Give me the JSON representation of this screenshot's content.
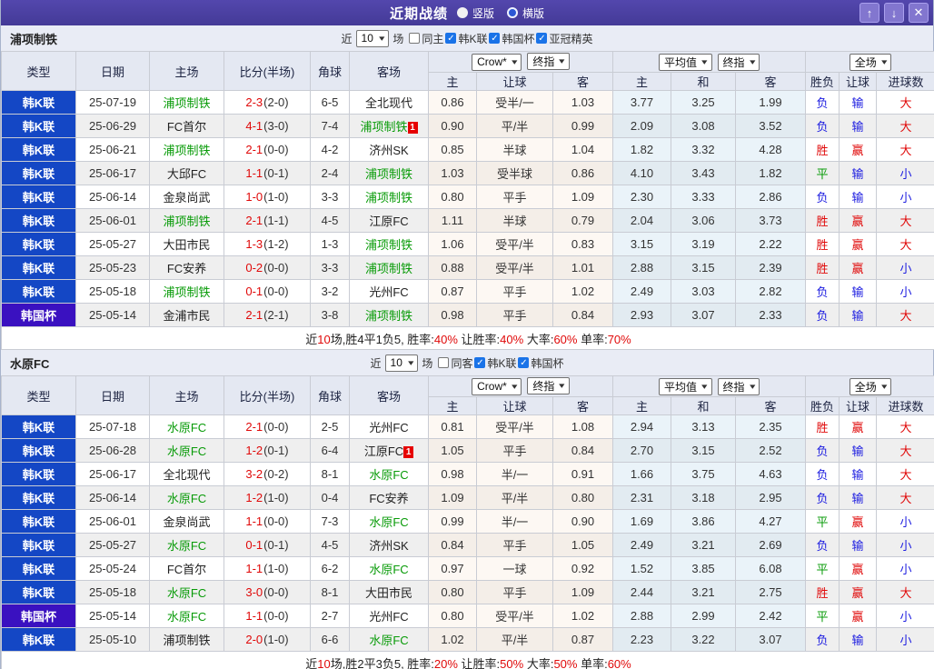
{
  "titlebar": {
    "title": "近期战绩",
    "radio_vertical": "竖版",
    "radio_horizontal": "横版",
    "up_glyph": "↑",
    "down_glyph": "↓",
    "close_glyph": "✕"
  },
  "header_template": {
    "main_cols": [
      "类型",
      "日期",
      "主场",
      "比分(半场)",
      "角球",
      "客场"
    ],
    "group1_dropdowns": [
      "Crow*",
      "终指"
    ],
    "group2_dropdowns": [
      "平均值",
      "终指"
    ],
    "group3_dropdowns": [
      "全场"
    ],
    "sub_cols": [
      "主",
      "让球",
      "客",
      "主",
      "和",
      "客",
      "胜负",
      "让球",
      "进球数"
    ],
    "check_glyph": "✓",
    "chevron_glyph": "▾"
  },
  "colors": {
    "league_k_bg": "#1447c5",
    "league_cup_bg": "#3a11c0",
    "self_team": "#089b08",
    "win_red": "#e00909",
    "draw_green": "#089b08",
    "lose_blue": "#1c1ce0",
    "titlebar_bg": "#443a97",
    "checkbox_accent": "#1a73e8"
  },
  "sections": [
    {
      "team": "浦项制铁",
      "filter": {
        "near": "近",
        "count": "10",
        "games": "场",
        "same": "同主",
        "same_checked": false,
        "leagues": [
          {
            "label": "韩K联",
            "checked": true
          },
          {
            "label": "韩国杯",
            "checked": true
          },
          {
            "label": "亚冠精英",
            "checked": true
          }
        ]
      },
      "rows": [
        {
          "lg": "韩K联",
          "cup": false,
          "date": "25-07-19",
          "home": "浦项制铁",
          "hs": true,
          "hb": "",
          "ft": "2-3",
          "ht": "(2-0)",
          "cor": "6-5",
          "away": "全北现代",
          "as": false,
          "ab": "",
          "a1": "0.86",
          "line": "受半/一",
          "a2": "1.03",
          "e1": "3.77",
          "e2": "3.25",
          "e3": "1.99",
          "r1": "负",
          "r2": "输",
          "r3": "大"
        },
        {
          "lg": "韩K联",
          "cup": false,
          "date": "25-06-29",
          "home": "FC首尔",
          "hs": false,
          "hb": "",
          "ft": "4-1",
          "ht": "(3-0)",
          "cor": "7-4",
          "away": "浦项制铁",
          "as": true,
          "ab": "1",
          "a1": "0.90",
          "line": "平/半",
          "a2": "0.99",
          "e1": "2.09",
          "e2": "3.08",
          "e3": "3.52",
          "r1": "负",
          "r2": "输",
          "r3": "大"
        },
        {
          "lg": "韩K联",
          "cup": false,
          "date": "25-06-21",
          "home": "浦项制铁",
          "hs": true,
          "hb": "",
          "ft": "2-1",
          "ht": "(0-0)",
          "cor": "4-2",
          "away": "济州SK",
          "as": false,
          "ab": "",
          "a1": "0.85",
          "line": "半球",
          "a2": "1.04",
          "e1": "1.82",
          "e2": "3.32",
          "e3": "4.28",
          "r1": "胜",
          "r2": "赢",
          "r3": "大"
        },
        {
          "lg": "韩K联",
          "cup": false,
          "date": "25-06-17",
          "home": "大邱FC",
          "hs": false,
          "hb": "",
          "ft": "1-1",
          "ht": "(0-1)",
          "cor": "2-4",
          "away": "浦项制铁",
          "as": true,
          "ab": "",
          "a1": "1.03",
          "line": "受半球",
          "a2": "0.86",
          "e1": "4.10",
          "e2": "3.43",
          "e3": "1.82",
          "r1": "平",
          "r2": "输",
          "r3": "小"
        },
        {
          "lg": "韩K联",
          "cup": false,
          "date": "25-06-14",
          "home": "金泉尚武",
          "hs": false,
          "hb": "",
          "ft": "1-0",
          "ht": "(1-0)",
          "cor": "3-3",
          "away": "浦项制铁",
          "as": true,
          "ab": "",
          "a1": "0.80",
          "line": "平手",
          "a2": "1.09",
          "e1": "2.30",
          "e2": "3.33",
          "e3": "2.86",
          "r1": "负",
          "r2": "输",
          "r3": "小"
        },
        {
          "lg": "韩K联",
          "cup": false,
          "date": "25-06-01",
          "home": "浦项制铁",
          "hs": true,
          "hb": "",
          "ft": "2-1",
          "ht": "(1-1)",
          "cor": "4-5",
          "away": "江原FC",
          "as": false,
          "ab": "",
          "a1": "1.11",
          "line": "半球",
          "a2": "0.79",
          "e1": "2.04",
          "e2": "3.06",
          "e3": "3.73",
          "r1": "胜",
          "r2": "赢",
          "r3": "大"
        },
        {
          "lg": "韩K联",
          "cup": false,
          "date": "25-05-27",
          "home": "大田市民",
          "hs": false,
          "hb": "",
          "ft": "1-3",
          "ht": "(1-2)",
          "cor": "1-3",
          "away": "浦项制铁",
          "as": true,
          "ab": "",
          "a1": "1.06",
          "line": "受平/半",
          "a2": "0.83",
          "e1": "3.15",
          "e2": "3.19",
          "e3": "2.22",
          "r1": "胜",
          "r2": "赢",
          "r3": "大"
        },
        {
          "lg": "韩K联",
          "cup": false,
          "date": "25-05-23",
          "home": "FC安养",
          "hs": false,
          "hb": "",
          "ft": "0-2",
          "ht": "(0-0)",
          "cor": "3-3",
          "away": "浦项制铁",
          "as": true,
          "ab": "",
          "a1": "0.88",
          "line": "受平/半",
          "a2": "1.01",
          "e1": "2.88",
          "e2": "3.15",
          "e3": "2.39",
          "r1": "胜",
          "r2": "赢",
          "r3": "小"
        },
        {
          "lg": "韩K联",
          "cup": false,
          "date": "25-05-18",
          "home": "浦项制铁",
          "hs": true,
          "hb": "",
          "ft": "0-1",
          "ht": "(0-0)",
          "cor": "3-2",
          "away": "光州FC",
          "as": false,
          "ab": "",
          "a1": "0.87",
          "line": "平手",
          "a2": "1.02",
          "e1": "2.49",
          "e2": "3.03",
          "e3": "2.82",
          "r1": "负",
          "r2": "输",
          "r3": "小"
        },
        {
          "lg": "韩国杯",
          "cup": true,
          "date": "25-05-14",
          "home": "金浦市民",
          "hs": false,
          "hb": "",
          "ft": "2-1",
          "ht": "(2-1)",
          "cor": "3-8",
          "away": "浦项制铁",
          "as": true,
          "ab": "",
          "a1": "0.98",
          "line": "平手",
          "a2": "0.84",
          "e1": "2.93",
          "e2": "3.07",
          "e3": "2.33",
          "r1": "负",
          "r2": "输",
          "r3": "大"
        }
      ],
      "summary": [
        {
          "t": "近",
          "c": "k"
        },
        {
          "t": "10",
          "c": "r"
        },
        {
          "t": "场,胜4平1负5, 胜率:",
          "c": "k"
        },
        {
          "t": "40%",
          "c": "r"
        },
        {
          "t": " 让胜率:",
          "c": "k"
        },
        {
          "t": "40%",
          "c": "r"
        },
        {
          "t": " 大率:",
          "c": "k"
        },
        {
          "t": "60%",
          "c": "r"
        },
        {
          "t": " 单率:",
          "c": "k"
        },
        {
          "t": "70%",
          "c": "r"
        }
      ]
    },
    {
      "team": "水原FC",
      "filter": {
        "near": "近",
        "count": "10",
        "games": "场",
        "same": "同客",
        "same_checked": false,
        "leagues": [
          {
            "label": "韩K联",
            "checked": true
          },
          {
            "label": "韩国杯",
            "checked": true
          }
        ]
      },
      "rows": [
        {
          "lg": "韩K联",
          "cup": false,
          "date": "25-07-18",
          "home": "水原FC",
          "hs": true,
          "hb": "",
          "ft": "2-1",
          "ht": "(0-0)",
          "cor": "2-5",
          "away": "光州FC",
          "as": false,
          "ab": "",
          "a1": "0.81",
          "line": "受平/半",
          "a2": "1.08",
          "e1": "2.94",
          "e2": "3.13",
          "e3": "2.35",
          "r1": "胜",
          "r2": "赢",
          "r3": "大"
        },
        {
          "lg": "韩K联",
          "cup": false,
          "date": "25-06-28",
          "home": "水原FC",
          "hs": true,
          "hb": "",
          "ft": "1-2",
          "ht": "(0-1)",
          "cor": "6-4",
          "away": "江原FC",
          "as": false,
          "ab": "1",
          "a1": "1.05",
          "line": "平手",
          "a2": "0.84",
          "e1": "2.70",
          "e2": "3.15",
          "e3": "2.52",
          "r1": "负",
          "r2": "输",
          "r3": "大"
        },
        {
          "lg": "韩K联",
          "cup": false,
          "date": "25-06-17",
          "home": "全北现代",
          "hs": false,
          "hb": "",
          "ft": "3-2",
          "ht": "(0-2)",
          "cor": "8-1",
          "away": "水原FC",
          "as": true,
          "ab": "",
          "a1": "0.98",
          "line": "半/一",
          "a2": "0.91",
          "e1": "1.66",
          "e2": "3.75",
          "e3": "4.63",
          "r1": "负",
          "r2": "输",
          "r3": "大"
        },
        {
          "lg": "韩K联",
          "cup": false,
          "date": "25-06-14",
          "home": "水原FC",
          "hs": true,
          "hb": "",
          "ft": "1-2",
          "ht": "(1-0)",
          "cor": "0-4",
          "away": "FC安养",
          "as": false,
          "ab": "",
          "a1": "1.09",
          "line": "平/半",
          "a2": "0.80",
          "e1": "2.31",
          "e2": "3.18",
          "e3": "2.95",
          "r1": "负",
          "r2": "输",
          "r3": "大"
        },
        {
          "lg": "韩K联",
          "cup": false,
          "date": "25-06-01",
          "home": "金泉尚武",
          "hs": false,
          "hb": "",
          "ft": "1-1",
          "ht": "(0-0)",
          "cor": "7-3",
          "away": "水原FC",
          "as": true,
          "ab": "",
          "a1": "0.99",
          "line": "半/一",
          "a2": "0.90",
          "e1": "1.69",
          "e2": "3.86",
          "e3": "4.27",
          "r1": "平",
          "r2": "赢",
          "r3": "小"
        },
        {
          "lg": "韩K联",
          "cup": false,
          "date": "25-05-27",
          "home": "水原FC",
          "hs": true,
          "hb": "",
          "ft": "0-1",
          "ht": "(0-1)",
          "cor": "4-5",
          "away": "济州SK",
          "as": false,
          "ab": "",
          "a1": "0.84",
          "line": "平手",
          "a2": "1.05",
          "e1": "2.49",
          "e2": "3.21",
          "e3": "2.69",
          "r1": "负",
          "r2": "输",
          "r3": "小"
        },
        {
          "lg": "韩K联",
          "cup": false,
          "date": "25-05-24",
          "home": "FC首尔",
          "hs": false,
          "hb": "",
          "ft": "1-1",
          "ht": "(1-0)",
          "cor": "6-2",
          "away": "水原FC",
          "as": true,
          "ab": "",
          "a1": "0.97",
          "line": "一球",
          "a2": "0.92",
          "e1": "1.52",
          "e2": "3.85",
          "e3": "6.08",
          "r1": "平",
          "r2": "赢",
          "r3": "小"
        },
        {
          "lg": "韩K联",
          "cup": false,
          "date": "25-05-18",
          "home": "水原FC",
          "hs": true,
          "hb": "",
          "ft": "3-0",
          "ht": "(0-0)",
          "cor": "8-1",
          "away": "大田市民",
          "as": false,
          "ab": "",
          "a1": "0.80",
          "line": "平手",
          "a2": "1.09",
          "e1": "2.44",
          "e2": "3.21",
          "e3": "2.75",
          "r1": "胜",
          "r2": "赢",
          "r3": "大"
        },
        {
          "lg": "韩国杯",
          "cup": true,
          "date": "25-05-14",
          "home": "水原FC",
          "hs": true,
          "hb": "",
          "ft": "1-1",
          "ht": "(0-0)",
          "cor": "2-7",
          "away": "光州FC",
          "as": false,
          "ab": "",
          "a1": "0.80",
          "line": "受平/半",
          "a2": "1.02",
          "e1": "2.88",
          "e2": "2.99",
          "e3": "2.42",
          "r1": "平",
          "r2": "赢",
          "r3": "小"
        },
        {
          "lg": "韩K联",
          "cup": false,
          "date": "25-05-10",
          "home": "浦项制铁",
          "hs": false,
          "hb": "",
          "ft": "2-0",
          "ht": "(1-0)",
          "cor": "6-6",
          "away": "水原FC",
          "as": true,
          "ab": "",
          "a1": "1.02",
          "line": "平/半",
          "a2": "0.87",
          "e1": "2.23",
          "e2": "3.22",
          "e3": "3.07",
          "r1": "负",
          "r2": "输",
          "r3": "小"
        }
      ],
      "summary": [
        {
          "t": "近",
          "c": "k"
        },
        {
          "t": "10",
          "c": "r"
        },
        {
          "t": "场,胜2平3负5, 胜率:",
          "c": "k"
        },
        {
          "t": "20%",
          "c": "r"
        },
        {
          "t": " 让胜率:",
          "c": "k"
        },
        {
          "t": "50%",
          "c": "r"
        },
        {
          "t": " 大率:",
          "c": "k"
        },
        {
          "t": "50%",
          "c": "r"
        },
        {
          "t": " 单率:",
          "c": "k"
        },
        {
          "t": "60%",
          "c": "r"
        }
      ]
    }
  ]
}
